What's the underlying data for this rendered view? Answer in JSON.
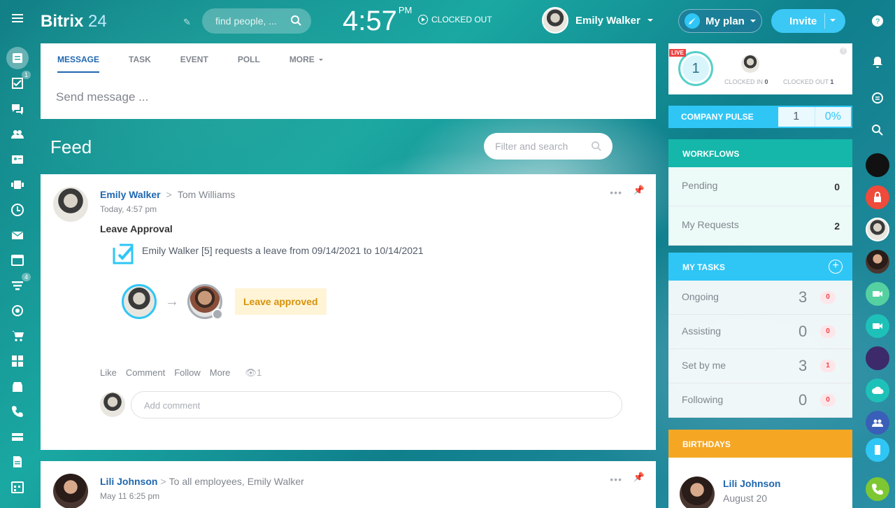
{
  "header": {
    "logo_main": "Bitrix",
    "logo_num": "24",
    "search_placeholder": "find people, ...",
    "time": "4:57",
    "ampm": "PM",
    "clock_status": "CLOCKED OUT",
    "user_name": "Emily Walker",
    "myplan_label": "My plan",
    "invite_label": "Invite"
  },
  "leftbar": {
    "badges": {
      "tasks": "1",
      "crm": "4"
    }
  },
  "composer": {
    "tabs": [
      "MESSAGE",
      "TASK",
      "EVENT",
      "POLL",
      "MORE"
    ],
    "placeholder": "Send message ..."
  },
  "feed": {
    "title": "Feed",
    "filter_placeholder": "Filter and search"
  },
  "posts": [
    {
      "author": "Emily Walker",
      "recipient": "Tom Williams",
      "time": "Today, 4:57 pm",
      "title": "Leave Approval",
      "text": "Emily Walker [5] requests a leave from 09/14/2021 to 10/14/2021",
      "status": "Leave approved",
      "actions": [
        "Like",
        "Comment",
        "Follow",
        "More"
      ],
      "views": "1",
      "comment_placeholder": "Add comment"
    },
    {
      "author": "Lili Johnson",
      "recipient": "To all employees, Emily Walker",
      "time": "May 11 6:25 pm"
    }
  ],
  "timeman": {
    "count": "1",
    "live": "LIVE",
    "clocked_in_label": "CLOCKED IN",
    "clocked_in": "0",
    "clocked_out_label": "CLOCKED OUT",
    "clocked_out": "1"
  },
  "pulse": {
    "label": "COMPANY PULSE",
    "value": "1",
    "percent": "0%"
  },
  "workflows": {
    "label": "WORKFLOWS",
    "rows": [
      {
        "label": "Pending",
        "value": "0"
      },
      {
        "label": "My Requests",
        "value": "2"
      }
    ]
  },
  "mytasks": {
    "label": "MY TASKS",
    "rows": [
      {
        "label": "Ongoing",
        "value": "3",
        "count": "0"
      },
      {
        "label": "Assisting",
        "value": "0",
        "count": "0"
      },
      {
        "label": "Set by me",
        "value": "3",
        "count": "1"
      },
      {
        "label": "Following",
        "value": "0",
        "count": "0"
      }
    ]
  },
  "birthdays": {
    "label": "BIRTHDAYS",
    "name": "Lili Johnson",
    "date": "August 20"
  },
  "colors": {
    "accent": "#2fc6f6",
    "workflows": "#14b7aa",
    "birthdays": "#f5a623",
    "link": "#2067b0"
  }
}
